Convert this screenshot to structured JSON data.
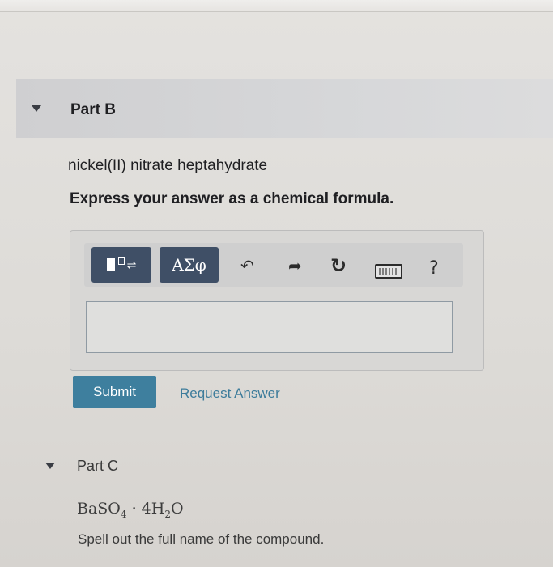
{
  "part_b": {
    "title": "Part B",
    "problem": "nickel(II) nitrate heptahydrate",
    "instruction": "Express your answer as a chemical formula."
  },
  "toolbar": {
    "template_icon": "template-superscript-icon",
    "greek_label": "ΑΣφ",
    "undo_icon": "↶",
    "redo_icon": "➦",
    "reset_icon": "↻",
    "keyboard_icon": "keyboard-icon",
    "help_label": "?"
  },
  "answer": {
    "value": "",
    "placeholder": ""
  },
  "actions": {
    "submit_label": "Submit",
    "request_answer_label": "Request Answer"
  },
  "part_c": {
    "title": "Part C",
    "formula_parts": {
      "base": "BaSO",
      "sub1": "4",
      "mid": " · 4H",
      "sub2": "2",
      "tail": "O"
    },
    "instruction": "Spell out the full name of the compound."
  },
  "colors": {
    "button_dark": "#3f4f66",
    "submit_bg": "#3e7f9e",
    "link": "#3d7c9b"
  }
}
